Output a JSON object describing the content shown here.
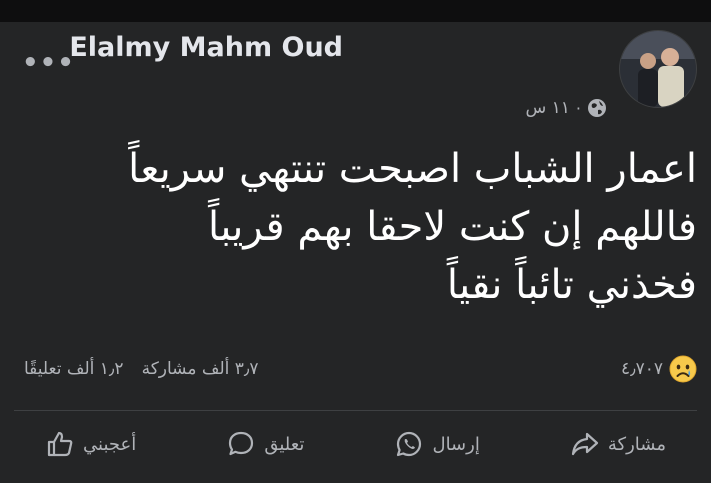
{
  "post": {
    "author_name": "Elalmy Mahm Oud",
    "time_label": "١١ س",
    "separator": "·",
    "text_lines": [
      "اعمار الشباب اصبحت تنتهي سريعاً",
      "فاللهم إن كنت لاحقا بهم قريباً",
      "فخذني تائباً نقياً"
    ]
  },
  "stats": {
    "reactions_count": "٤٫٧٠٧",
    "comments_label": "١٫٢ ألف تعليقًا",
    "shares_label": "٣٫٧ ألف مشاركة"
  },
  "actions": {
    "like_label": "أعجبني",
    "comment_label": "تعليق",
    "send_label": "إرسال",
    "share_label": "مشاركة"
  },
  "icons": {
    "more": "more-dots-icon",
    "privacy": "globe-icon",
    "reaction": "sad-emoji-icon",
    "like": "thumbs-up-icon",
    "comment": "comment-bubble-icon",
    "send": "whatsapp-icon",
    "share": "share-arrow-icon"
  },
  "colors": {
    "background": "#242526",
    "text_primary": "#e4e6eb",
    "text_secondary": "#b0b3b8"
  }
}
